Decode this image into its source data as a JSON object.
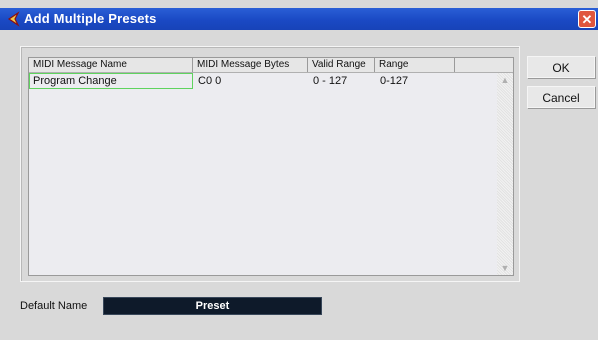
{
  "window": {
    "title": "Add Multiple Presets"
  },
  "table": {
    "headers": [
      "MIDI Message Name",
      "MIDI Message Bytes",
      "Valid Range",
      "Range",
      ""
    ],
    "rows": [
      {
        "name": "Program Change",
        "bytes": "C0 0",
        "valid_range": "0 - 127",
        "range": "0-127"
      }
    ]
  },
  "buttons": {
    "ok": "OK",
    "cancel": "Cancel"
  },
  "default_name": {
    "label": "Default Name",
    "value": "Preset"
  },
  "colors": {
    "titlebar": "#1a49c4",
    "selection_border": "#5fd35f",
    "field_bg": "#0e1a2a"
  }
}
